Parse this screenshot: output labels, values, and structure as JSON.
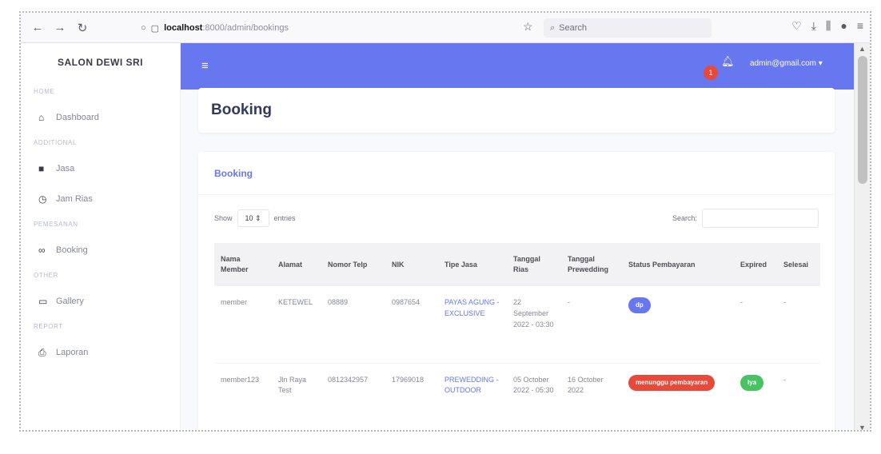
{
  "browser": {
    "url_host": "localhost",
    "url_path": ":8000/admin/bookings",
    "search_placeholder": "Search"
  },
  "sidebar": {
    "brand": "SALON DEWI SRI",
    "sections": [
      {
        "heading": "HOME",
        "items": [
          {
            "label": "Dashboard",
            "icon": "home-icon"
          }
        ]
      },
      {
        "heading": "ADDITIONAL",
        "items": [
          {
            "label": "Jasa",
            "icon": "briefcase-icon"
          },
          {
            "label": "Jam Rias",
            "icon": "clock-icon"
          }
        ]
      },
      {
        "heading": "PEMESANAN",
        "items": [
          {
            "label": "Booking",
            "icon": "link-icon"
          }
        ]
      },
      {
        "heading": "OTHER",
        "items": [
          {
            "label": "Gallery",
            "icon": "image-icon"
          }
        ]
      },
      {
        "heading": "REPORT",
        "items": [
          {
            "label": "Laporan",
            "icon": "print-icon"
          }
        ]
      }
    ]
  },
  "topbar": {
    "notification_count": "1",
    "user_email": "admin@gmail.com"
  },
  "page": {
    "title": "Booking"
  },
  "card": {
    "title": "Booking",
    "show_label": "Show",
    "entries_value": "10",
    "entries_label": "entries",
    "search_label": "Search:"
  },
  "table": {
    "headers": [
      "Nama Member",
      "Alamat",
      "Nomor Telp",
      "NIK",
      "Tipe Jasa",
      "Tanggal Rias",
      "Tanggal Prewedding",
      "Status Pembayaran",
      "Expired",
      "Selesai"
    ],
    "rows": [
      {
        "nama": "member",
        "alamat": "KETEWEL",
        "telp": "08889",
        "nik": "0987654",
        "tipe": "PAYAS AGUNG - EXCLUSIVE",
        "tgl_rias": "22 September 2022 - 03:30",
        "tgl_prewedding": "-",
        "status": "dp",
        "status_color": "#6777ef",
        "expired": "-",
        "expired_badge": "",
        "selesai": "-"
      },
      {
        "nama": "member123",
        "alamat": "Jln Raya Test",
        "telp": "0812342957",
        "nik": "17969018",
        "tipe": "PREWEDDING - OUTDOOR",
        "tgl_rias": "05 October 2022 - 05:30",
        "tgl_prewedding": "16 October 2022",
        "status": "menunggu pembayaran",
        "status_color": "#e74a3b",
        "expired": "",
        "expired_badge": "Iya",
        "expired_color": "#47c363",
        "selesai": "-"
      }
    ]
  }
}
